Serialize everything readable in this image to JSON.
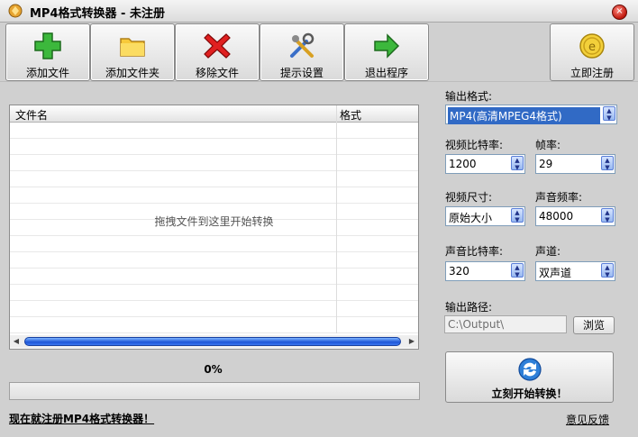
{
  "window": {
    "title": "MP4格式转换器 - 未注册",
    "close_glyph": "×"
  },
  "toolbar": {
    "add_file": "添加文件",
    "add_folder": "添加文件夹",
    "remove_file": "移除文件",
    "prompt_settings": "提示设置",
    "exit_program": "退出程序",
    "register_now": "立即注册"
  },
  "file_list": {
    "columns": [
      "文件名",
      "格式"
    ],
    "drop_hint": "拖拽文件到这里开始转换"
  },
  "progress": {
    "percent_text": "0%",
    "value": 0
  },
  "footer": {
    "register_link": "现在就注册MP4格式转换器！",
    "feedback_link": "意见反馈"
  },
  "settings": {
    "output_format_label": "输出格式:",
    "output_format_value": "MP4(高清MPEG4格式)",
    "video_bitrate_label": "视频比特率:",
    "video_bitrate_value": "1200",
    "frame_rate_label": "帧率:",
    "frame_rate_value": "29",
    "video_size_label": "视频尺寸:",
    "video_size_value": "原始大小",
    "audio_rate_label": "声音频率:",
    "audio_rate_value": "48000",
    "audio_bitrate_label": "声音比特率:",
    "audio_bitrate_value": "320",
    "channel_label": "声道:",
    "channel_value": "双声道",
    "output_path_label": "输出路径:",
    "output_path_value": "C:\\Output\\",
    "browse_label": "浏览",
    "start_label": "立刻开始转换！"
  },
  "colors": {
    "accent": "#316ac5",
    "progress_thumb": "#1e56d8"
  }
}
